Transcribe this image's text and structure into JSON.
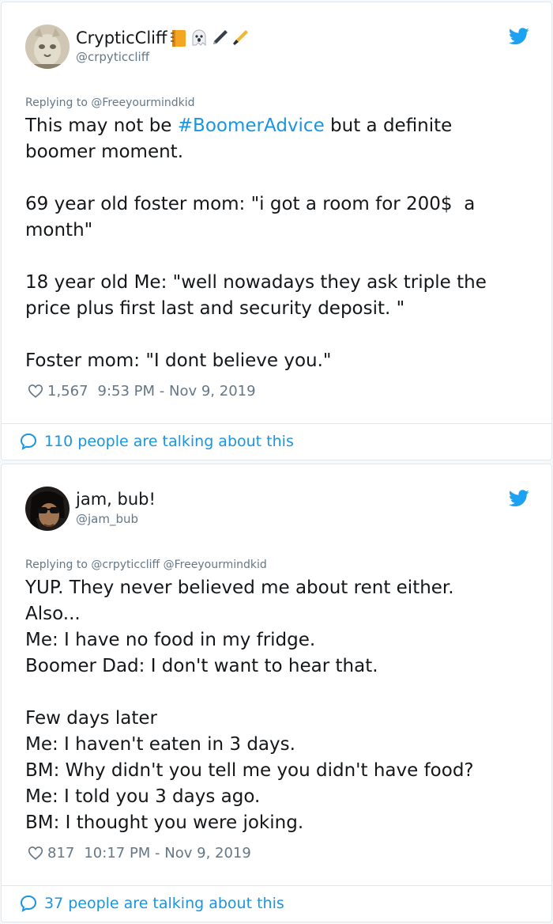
{
  "tweets": [
    {
      "display_name": "CrypticCliff",
      "emojis": [
        "notebook-icon",
        "ghost-icon",
        "pen-icon",
        "fountain-pen-icon"
      ],
      "handle": "@crpyticcliff",
      "replying_to": "Replying to @Freeyourmindkid",
      "lines": [
        {
          "before": "This may not be ",
          "hashtag": "#BoomerAdvice",
          "after": " but a definite"
        },
        {
          "before": "boomer moment.",
          "hashtag": "",
          "after": ""
        },
        {
          "before": "",
          "hashtag": "",
          "after": ""
        },
        {
          "before": "69 year old foster mom: \"i got a room for 200$  a",
          "hashtag": "",
          "after": ""
        },
        {
          "before": "month\"",
          "hashtag": "",
          "after": ""
        },
        {
          "before": "",
          "hashtag": "",
          "after": ""
        },
        {
          "before": "18 year old Me: \"well nowadays they ask triple the",
          "hashtag": "",
          "after": ""
        },
        {
          "before": "price plus first last and security deposit. \"",
          "hashtag": "",
          "after": ""
        },
        {
          "before": "",
          "hashtag": "",
          "after": ""
        },
        {
          "before": "Foster mom: \"I dont believe you.\"",
          "hashtag": "",
          "after": ""
        }
      ],
      "likes": "1,567",
      "timestamp": "9:53 PM - Nov 9, 2019",
      "talking": "110 people are talking about this"
    },
    {
      "display_name": "jam, bub!",
      "emojis": [],
      "handle": "@jam_bub",
      "replying_to": "Replying to @crpyticcliff @Freeyourmindkid",
      "lines": [
        {
          "before": "YUP. They never believed me about rent either.",
          "hashtag": "",
          "after": ""
        },
        {
          "before": "Also...",
          "hashtag": "",
          "after": ""
        },
        {
          "before": "Me: I have no food in my fridge.",
          "hashtag": "",
          "after": ""
        },
        {
          "before": "Boomer Dad: I don't want to hear that.",
          "hashtag": "",
          "after": ""
        },
        {
          "before": "",
          "hashtag": "",
          "after": ""
        },
        {
          "before": "Few days later",
          "hashtag": "",
          "after": ""
        },
        {
          "before": "Me: I haven't eaten in 3 days.",
          "hashtag": "",
          "after": ""
        },
        {
          "before": "BM: Why didn't you tell me you didn't have food?",
          "hashtag": "",
          "after": ""
        },
        {
          "before": "Me: I told you 3 days ago.",
          "hashtag": "",
          "after": ""
        },
        {
          "before": "BM: I thought you were joking.",
          "hashtag": "",
          "after": ""
        }
      ],
      "likes": "817",
      "timestamp": "10:17 PM - Nov 9, 2019",
      "talking": "37 people are talking about this"
    }
  ],
  "colors": {
    "link": "#1b95e0",
    "muted": "#657786",
    "text": "#14171a",
    "border": "#e1e8ed"
  }
}
